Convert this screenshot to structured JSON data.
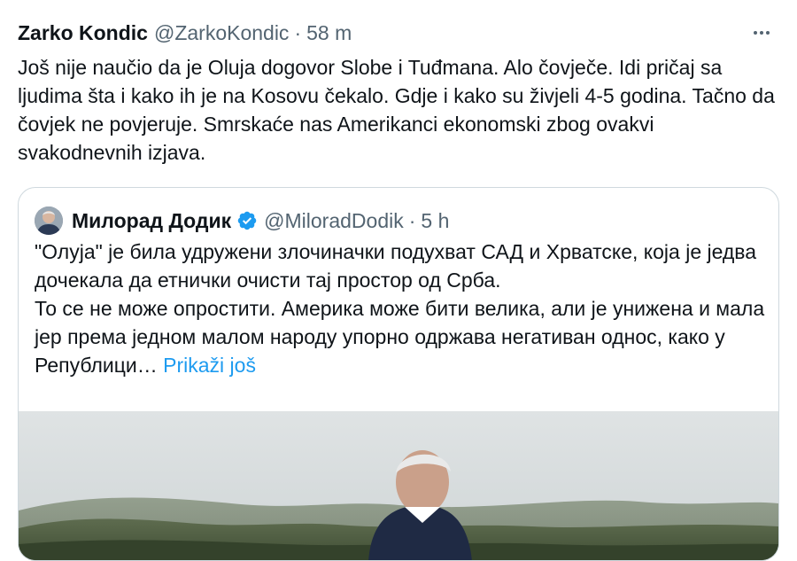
{
  "tweet": {
    "author_name": "Zarko Kondic",
    "author_handle": "@ZarkoKondic",
    "separator": "·",
    "time": "58 m",
    "text": "Još nije naučio da je Oluja dogovor Slobe i Tuđmana. Alo čovječe. Idi pričaj sa ljudima šta i kako ih je na Kosovu čekalo. Gdje i kako su živjeli 4-5 godina. Tačno da čovjek ne povjeruje. Smrskaće nas Amerikanci ekonomski zbog ovakvi svakodnevnih izjava.",
    "more_icon": "more-horizontal-icon"
  },
  "quote": {
    "author_name": "Милорад Додик",
    "author_handle": "@MiloradDodik",
    "separator": "·",
    "time": "5 h",
    "verified_icon": "verified-badge-icon",
    "verified_color": "#1d9bf0",
    "paragraph1": "\"Олуја\" је била удружени злочиначки подухват САД и Хрватске, која је једва дочекала да етнички очисти тај простор од Срба.",
    "paragraph2": "То се не може опростити. Америка може бити велика, али је унижена и мала јер према једном малом народу упорно одржава негативан однос, како у Републици…",
    "show_more": "Prikaži još",
    "show_more_color": "#1d9bf0"
  }
}
